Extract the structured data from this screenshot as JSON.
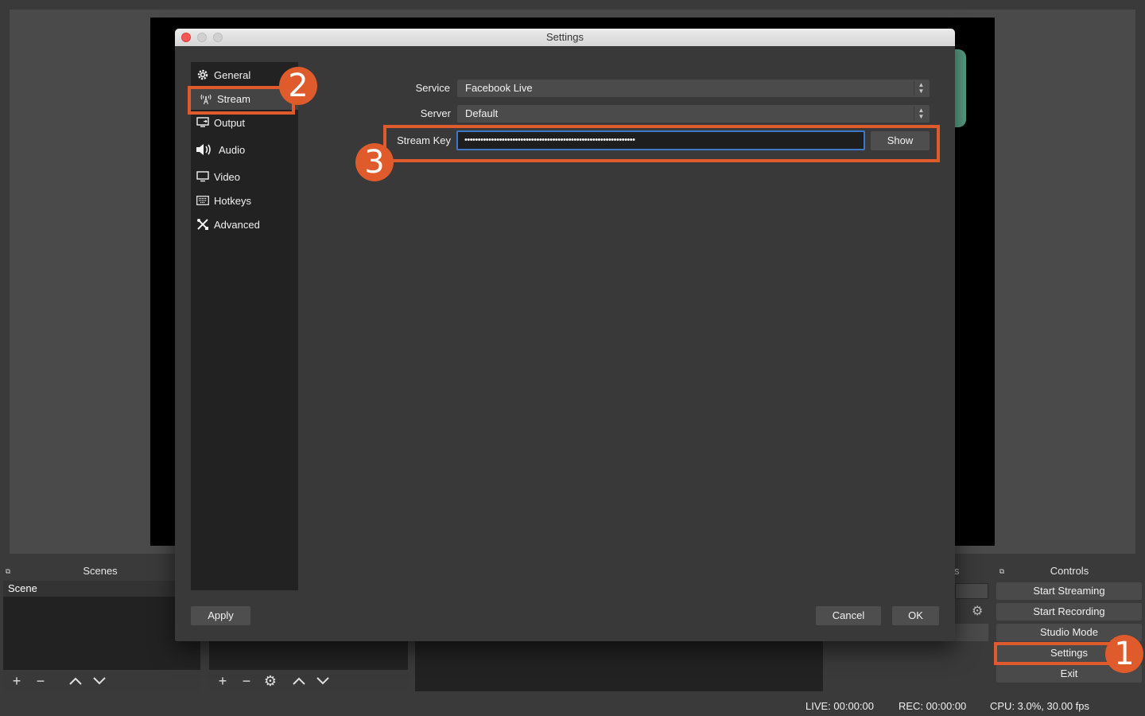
{
  "main": {
    "scenes_title": "Scenes",
    "scene_item": "Scene",
    "controls_title": "Controls",
    "sources_partial": "s",
    "controls": [
      "Start Streaming",
      "Start Recording",
      "Studio Mode",
      "Settings",
      "Exit"
    ],
    "status": {
      "live": "LIVE: 00:00:00",
      "rec": "REC: 00:00:00",
      "cpu": "CPU: 3.0%, 30.00 fps"
    }
  },
  "dialog": {
    "title": "Settings",
    "sidebar": [
      {
        "label": "General",
        "icon": "gear-icon"
      },
      {
        "label": "Stream",
        "icon": "broadcast-icon"
      },
      {
        "label": "Output",
        "icon": "output-icon"
      },
      {
        "label": "Audio",
        "icon": "speaker-icon"
      },
      {
        "label": "Video",
        "icon": "monitor-icon"
      },
      {
        "label": "Hotkeys",
        "icon": "keyboard-icon"
      },
      {
        "label": "Advanced",
        "icon": "tools-icon"
      }
    ],
    "active_item": "Stream",
    "service_label": "Service",
    "service_value": "Facebook Live",
    "server_label": "Server",
    "server_value": "Default",
    "stream_key_label": "Stream Key",
    "stream_key_value": "••••••••••••••••••••••••••••••••••••••••••••••••••••••••••••••••",
    "show_button": "Show",
    "apply_button": "Apply",
    "cancel_button": "Cancel",
    "ok_button": "OK"
  },
  "annotations": {
    "badge_1": "1",
    "badge_2": "2",
    "badge_3": "3",
    "color": "#e05b2b"
  }
}
